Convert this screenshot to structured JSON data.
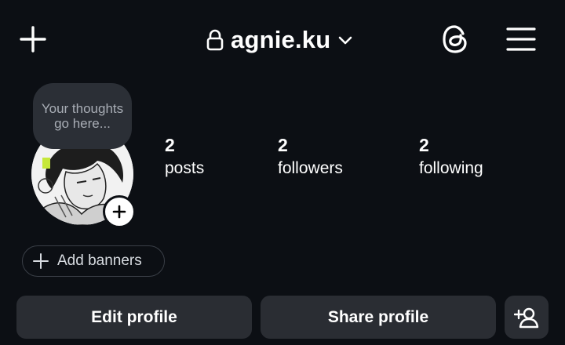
{
  "header": {
    "username": "agnie.ku",
    "icons": {
      "new_post": "plus-icon",
      "private": "lock-icon",
      "account_switch": "chevron-down-icon",
      "threads": "threads-icon",
      "menu": "hamburger-menu-icon"
    }
  },
  "profile": {
    "note_placeholder": "Your thoughts go here...",
    "stats": [
      {
        "count": "2",
        "label": "posts"
      },
      {
        "count": "2",
        "label": "followers"
      },
      {
        "count": "2",
        "label": "following"
      }
    ],
    "add_banners_label": "Add banners"
  },
  "actions": {
    "edit_label": "Edit profile",
    "share_label": "Share profile",
    "discover_people_icon": "add-person-icon"
  },
  "colors": {
    "background": "#0c0f14",
    "button": "#2a2d33",
    "note_bubble": "#2b2f36",
    "text": "#ffffff"
  }
}
